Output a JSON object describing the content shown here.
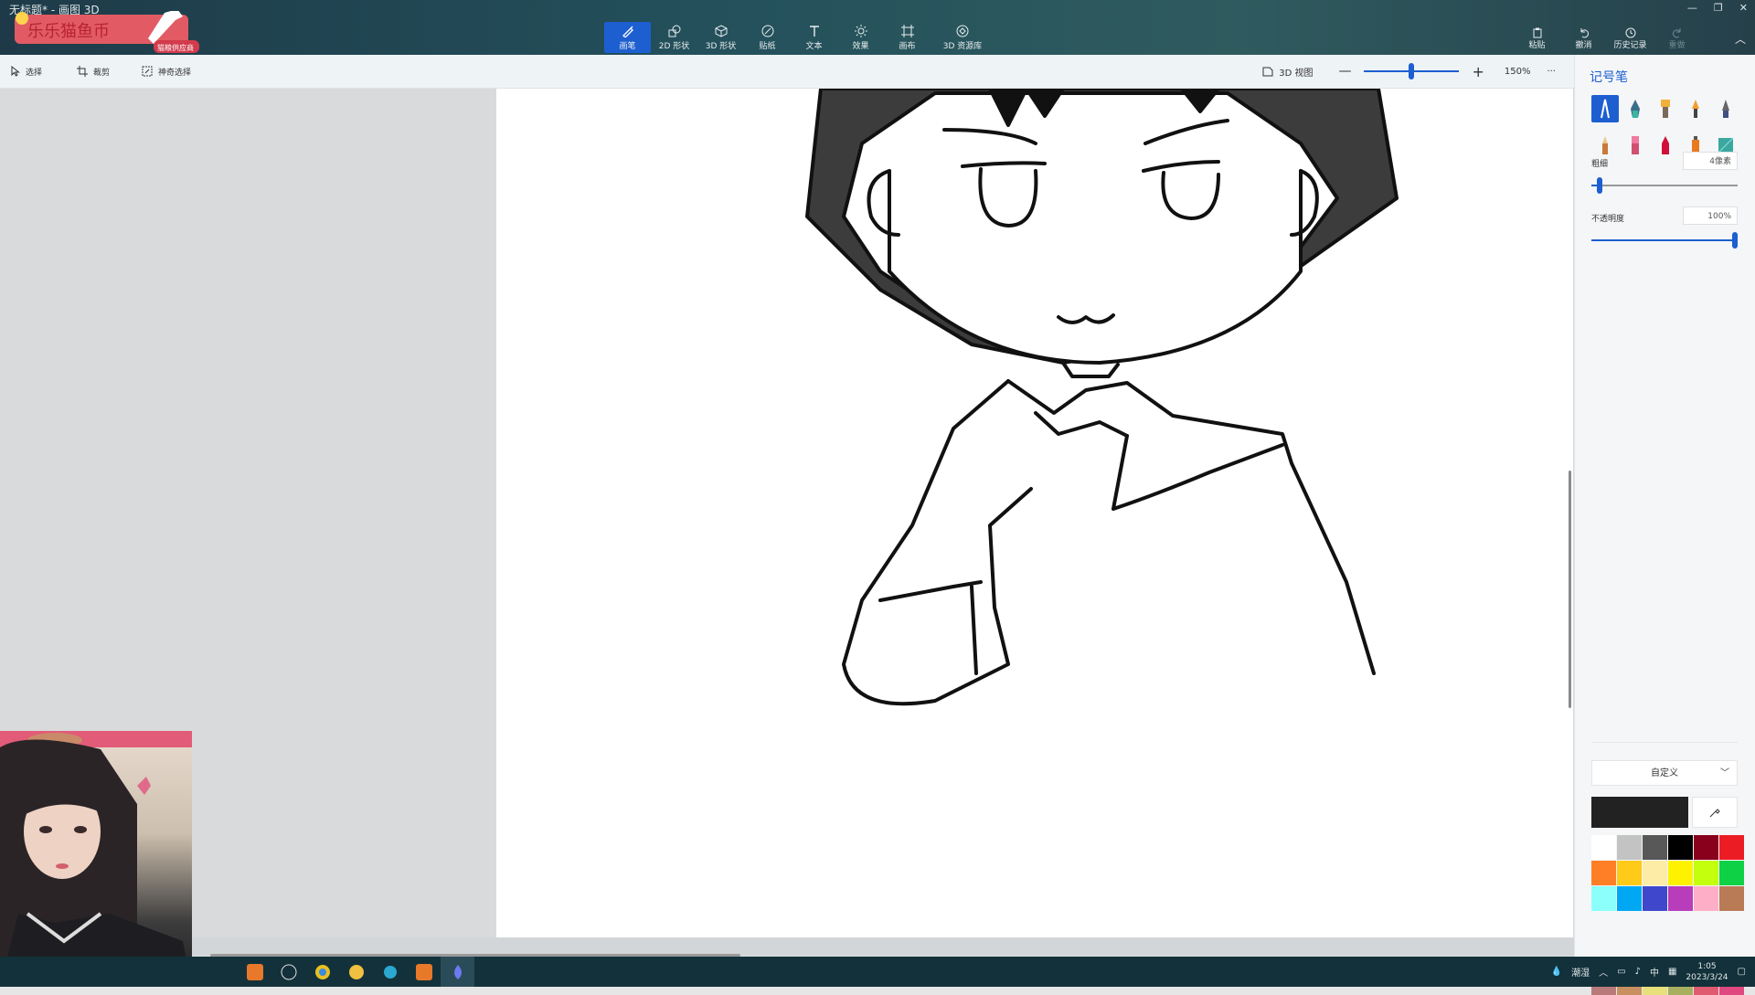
{
  "window": {
    "title": "无标题* - 画图 3D"
  },
  "overlay": {
    "banner_text": "乐乐猫鱼币",
    "badge_text": "猫粮供应商"
  },
  "toolbar": {
    "tools": [
      {
        "label": "画笔",
        "icon": "brush-icon",
        "active": true
      },
      {
        "label": "2D 形状",
        "icon": "2d-shapes-icon"
      },
      {
        "label": "3D 形状",
        "icon": "3d-shapes-icon"
      },
      {
        "label": "贴纸",
        "icon": "stickers-icon"
      },
      {
        "label": "文本",
        "icon": "text-icon"
      },
      {
        "label": "效果",
        "icon": "effects-icon"
      },
      {
        "label": "画布",
        "icon": "canvas-icon"
      },
      {
        "label": "3D 资源库",
        "icon": "3d-library-icon"
      }
    ],
    "right": [
      {
        "label": "粘贴",
        "icon": "paste-icon"
      },
      {
        "label": "撤消",
        "icon": "undo-icon"
      },
      {
        "label": "历史记录",
        "icon": "history-icon"
      },
      {
        "label": "重做",
        "icon": "redo-icon",
        "disabled": true
      }
    ]
  },
  "subbar": {
    "select": "选择",
    "crop": "裁剪",
    "magic_select": "神奇选择",
    "view_3d": "3D 视图",
    "zoom": "150%",
    "zoom_level": 0.5
  },
  "panel": {
    "title": "记号笔",
    "thickness_label": "粗细",
    "thickness_value": "4像素",
    "thickness_level": 0.04,
    "opacity_label": "不透明度",
    "opacity_value": "100%",
    "opacity_level": 1.0,
    "color_mode": "自定义",
    "current_color": "#222222",
    "palette": [
      "#ffffff",
      "#c3c3c3",
      "#585858",
      "#000000",
      "#88001b",
      "#ec1c24",
      "#ff7f27",
      "#ffca18",
      "#fdeca6",
      "#fff200",
      "#c4ff0e",
      "#0ed145",
      "#8cfffb",
      "#00a8f3",
      "#3f48cc",
      "#b83dba",
      "#ffaec8",
      "#b97a56"
    ],
    "palette_row2": [
      "#b97a7a",
      "#c89060",
      "#e8e07a",
      "#a8b060",
      "#e05a70",
      "#e04880"
    ]
  },
  "taskbar": {
    "weather": "潮湿",
    "time": "1:05",
    "date": "2023/3/24",
    "ime": "中"
  }
}
